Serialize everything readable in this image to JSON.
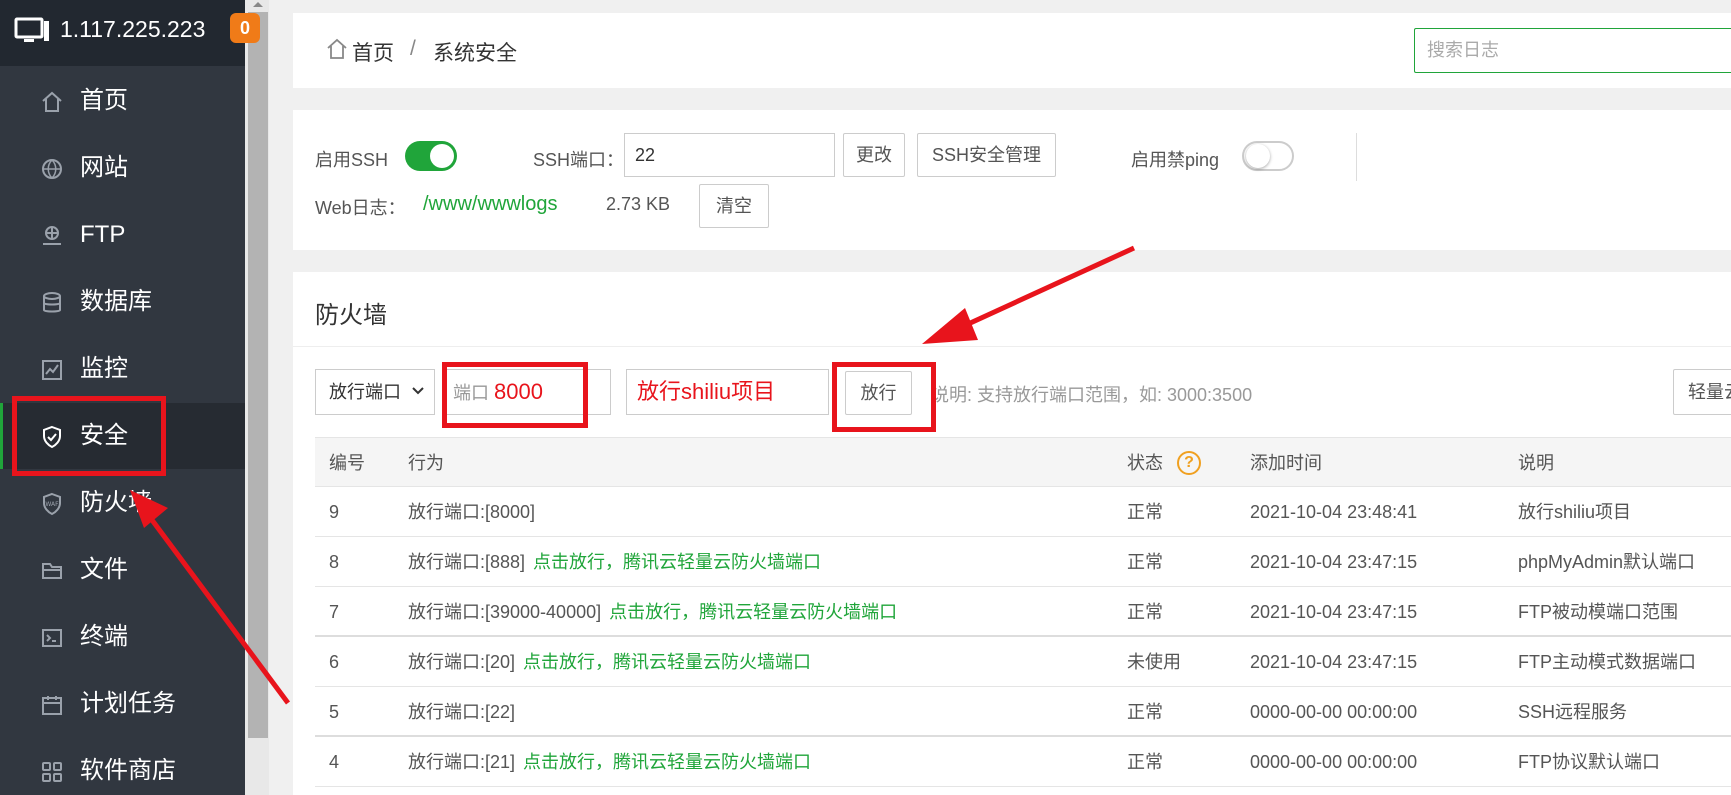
{
  "server": {
    "ip": "1.117.225.223",
    "badge": "0"
  },
  "sidebar": {
    "items": [
      {
        "label": "首页",
        "icon": "home-icon"
      },
      {
        "label": "网站",
        "icon": "globe-icon"
      },
      {
        "label": "FTP",
        "icon": "ftp-icon"
      },
      {
        "label": "数据库",
        "icon": "database-icon"
      },
      {
        "label": "监控",
        "icon": "monitor-chart-icon"
      },
      {
        "label": "安全",
        "icon": "shield-check-icon",
        "active": true
      },
      {
        "label": "防火墙",
        "icon": "waf-shield-icon"
      },
      {
        "label": "文件",
        "icon": "folder-icon"
      },
      {
        "label": "终端",
        "icon": "terminal-icon"
      },
      {
        "label": "计划任务",
        "icon": "calendar-icon"
      },
      {
        "label": "软件商店",
        "icon": "apps-grid-icon"
      }
    ]
  },
  "header": {
    "breadcrumb_home": "首页",
    "breadcrumb_sep": "/",
    "breadcrumb_current": "系统安全",
    "search_placeholder": "搜索日志"
  },
  "ssh": {
    "enable_ssh_label": "启用SSH",
    "enable_ssh_on": true,
    "port_label": "SSH端口：",
    "port_value": "22",
    "change_button": "更改",
    "manage_button": "SSH安全管理",
    "ping_label": "启用禁ping",
    "ping_on": false,
    "weblog_label": "Web日志：",
    "weblog_path": "/www/wwwlogs",
    "weblog_size": "2.73 KB",
    "clear_button": "清空"
  },
  "firewall": {
    "title": "防火墙",
    "mode_select": "放行端口",
    "port_placeholder": "端口",
    "port_value": "8000",
    "note_value": "放行shiliu项目",
    "allow_button": "放行",
    "desc": "说明: 支持放行端口范围，如: 3000:3500",
    "right_button": "轻量云",
    "columns": [
      "编号",
      "行为",
      "状态",
      "添加时间",
      "说明"
    ],
    "help_glyph": "?",
    "rows": [
      {
        "id": "9",
        "action": "放行端口:[8000]",
        "link": "",
        "status": "正常",
        "time": "2021-10-04 23:48:41",
        "note": "放行shiliu项目"
      },
      {
        "id": "8",
        "action": "放行端口:[888]",
        "link": "点击放行，腾讯云轻量云防火墙端口",
        "status": "正常",
        "time": "2021-10-04 23:47:15",
        "note": "phpMyAdmin默认端口"
      },
      {
        "id": "7",
        "action": "放行端口:[39000-40000]",
        "link": "点击放行，腾讯云轻量云防火墙端口",
        "status": "正常",
        "time": "2021-10-04 23:47:15",
        "note": "FTP被动模端口范围"
      },
      {
        "id": "6",
        "action": "放行端口:[20]",
        "link": "点击放行，腾讯云轻量云防火墙端口",
        "status": "未使用",
        "time": "2021-10-04 23:47:15",
        "note": "FTP主动模式数据端口"
      },
      {
        "id": "5",
        "action": "放行端口:[22]",
        "link": "",
        "status": "正常",
        "time": "0000-00-00 00:00:00",
        "note": "SSH远程服务"
      },
      {
        "id": "4",
        "action": "放行端口:[21]",
        "link": "点击放行，腾讯云轻量云防火墙端口",
        "status": "正常",
        "time": "0000-00-00 00:00:00",
        "note": "FTP协议默认端口"
      }
    ]
  },
  "colors": {
    "accent": "#20a53a",
    "sidebar": "#313740",
    "annotation": "#e8141c",
    "badge": "#f07b18"
  }
}
